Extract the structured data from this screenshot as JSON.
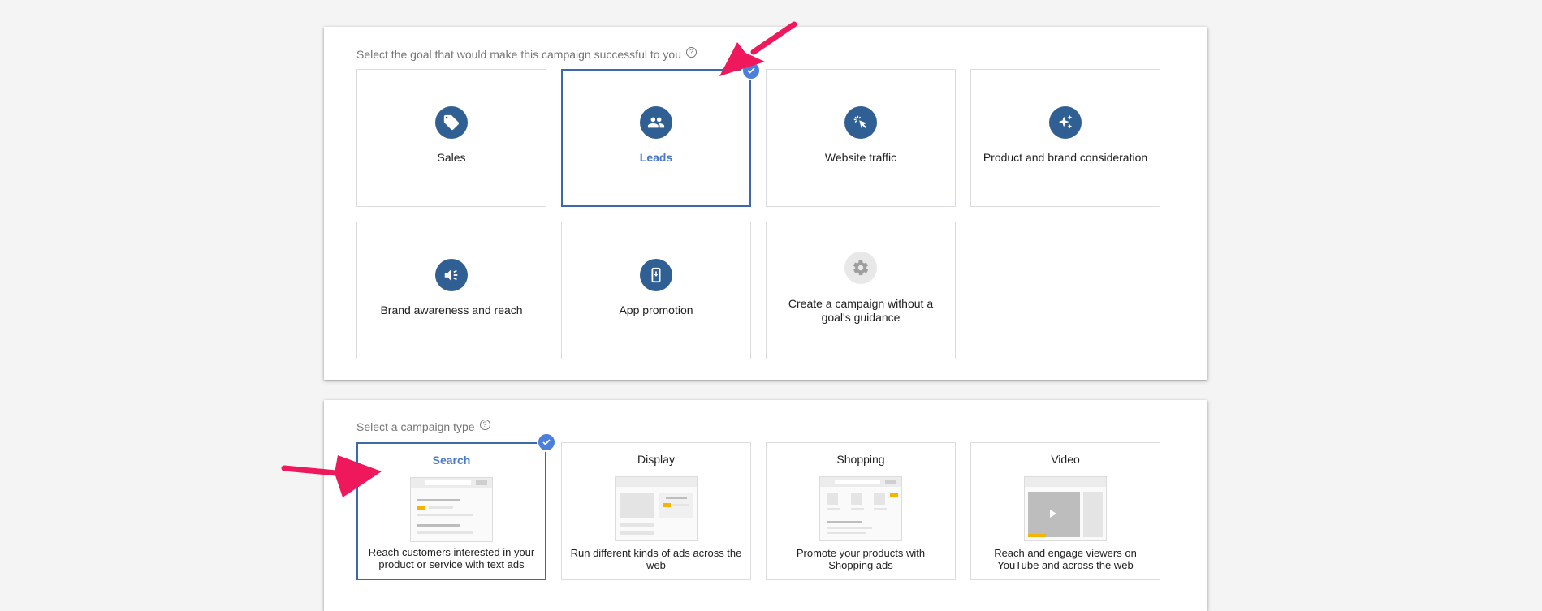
{
  "goal_section": {
    "heading": "Select the goal that would make this campaign successful to you",
    "help_icon": "?",
    "goals": [
      {
        "label": "Sales",
        "icon": "tag-icon",
        "selected": false
      },
      {
        "label": "Leads",
        "icon": "people-icon",
        "selected": true
      },
      {
        "label": "Website traffic",
        "icon": "cursor-click-icon",
        "selected": false
      },
      {
        "label": "Product and brand consideration",
        "icon": "sparkle-icon",
        "selected": false
      },
      {
        "label": "Brand awareness and reach",
        "icon": "speaker-icon",
        "selected": false
      },
      {
        "label": "App promotion",
        "icon": "phone-download-icon",
        "selected": false
      },
      {
        "label": "Create a campaign without a goal's guidance",
        "icon": "gear-icon",
        "selected": false
      }
    ]
  },
  "type_section": {
    "heading": "Select a campaign type",
    "help_icon": "?",
    "types": [
      {
        "title": "Search",
        "description": "Reach customers interested in your product or service with text ads",
        "selected": true
      },
      {
        "title": "Display",
        "description": "Run different kinds of ads across the web",
        "selected": false
      },
      {
        "title": "Shopping",
        "description": "Promote your products with Shopping ads",
        "selected": false
      },
      {
        "title": "Video",
        "description": "Reach and engage viewers on YouTube and across the web",
        "selected": false
      }
    ]
  },
  "colors": {
    "icon_bg": "#305f94",
    "selected_border": "#3c6aa8",
    "selected_text": "#4a7ac8",
    "check_badge": "#4a7fdc",
    "annotation_arrow": "#f0185c"
  }
}
